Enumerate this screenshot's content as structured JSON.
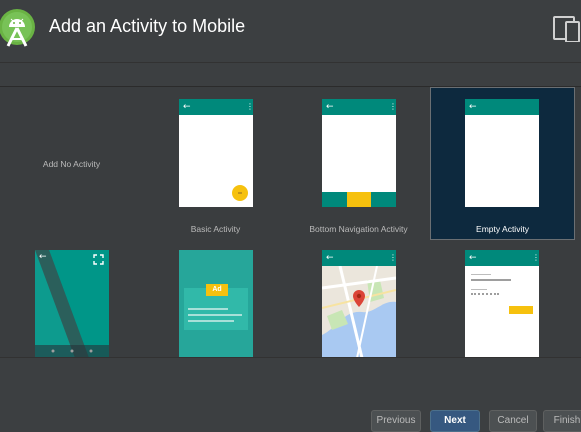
{
  "window": {
    "title": "Add an Activity to Mobile",
    "logo_icon": "android-studio-logo-icon",
    "device_icon": "phone-tablet-icon"
  },
  "templates": [
    {
      "label": "Add No Activity",
      "kind": "none",
      "selected": false
    },
    {
      "label": "Basic Activity",
      "kind": "basic",
      "selected": false
    },
    {
      "label": "Bottom Navigation Activity",
      "kind": "bottom-nav",
      "selected": false
    },
    {
      "label": "Empty Activity",
      "kind": "empty",
      "selected": true
    },
    {
      "label": "",
      "kind": "fullscreen",
      "selected": false
    },
    {
      "label": "",
      "kind": "admob",
      "selected": false,
      "ad_text": "Ad"
    },
    {
      "label": "",
      "kind": "maps",
      "selected": false
    },
    {
      "label": "",
      "kind": "login",
      "selected": false
    }
  ],
  "footer": {
    "previous": "Previous",
    "next": "Next",
    "cancel": "Cancel",
    "finish": "Finish"
  },
  "colors": {
    "background": "#3c3f41",
    "app_bar": "#00897b",
    "accent": "#f6c10e",
    "selection": "#0d293e",
    "primary_button": "#365880"
  }
}
